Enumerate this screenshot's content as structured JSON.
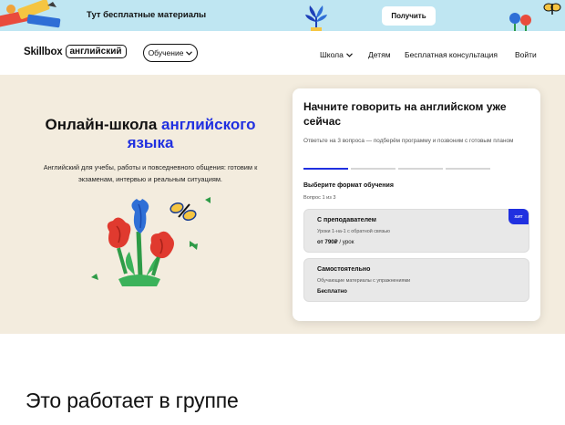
{
  "promo": {
    "text": "Тут бесплатные материалы",
    "button_label": "Получить"
  },
  "header": {
    "logo_brand": "Skillbox",
    "logo_badge": "английский",
    "learn_button": "Обучение",
    "nav": [
      {
        "label": "Школа",
        "dropdown": true
      },
      {
        "label": "Детям",
        "dropdown": false
      },
      {
        "label": "Бесплатная консультация",
        "dropdown": false
      },
      {
        "label": "Войти",
        "dropdown": false
      }
    ]
  },
  "hero": {
    "title_part1": "Онлайн-школа",
    "title_highlight": "английского языка",
    "subtitle": "Английский для учебы, работы и повседневного общения: готовим к экзаменам, интервью и реальным ситуациям."
  },
  "quiz": {
    "title": "Начните говорить на английском уже сейчас",
    "description": "Ответьте на 3 вопроса — подберём программу и позвоним с готовым планом",
    "progress_steps": 4,
    "current_step": 1,
    "question_label": "Выберите формат обучения",
    "step_text": "Вопрос 1 из 3",
    "options": [
      {
        "title": "С преподавателем",
        "desc": "Уроки 1-на-1 с обратной связью",
        "price_bold": "от 790₽",
        "price_rest": " / урок",
        "badge": "ХИТ"
      },
      {
        "title": "Самостоятельно",
        "desc": "Обучающие материалы с упражнениями",
        "price_bold": "Бесплатно",
        "price_rest": "",
        "badge": ""
      }
    ]
  },
  "section": {
    "title": "Это работает в группе"
  },
  "colors": {
    "accent": "#2030e0",
    "promo_bg": "#bfe6f2",
    "hero_bg": "#f3ecde"
  }
}
